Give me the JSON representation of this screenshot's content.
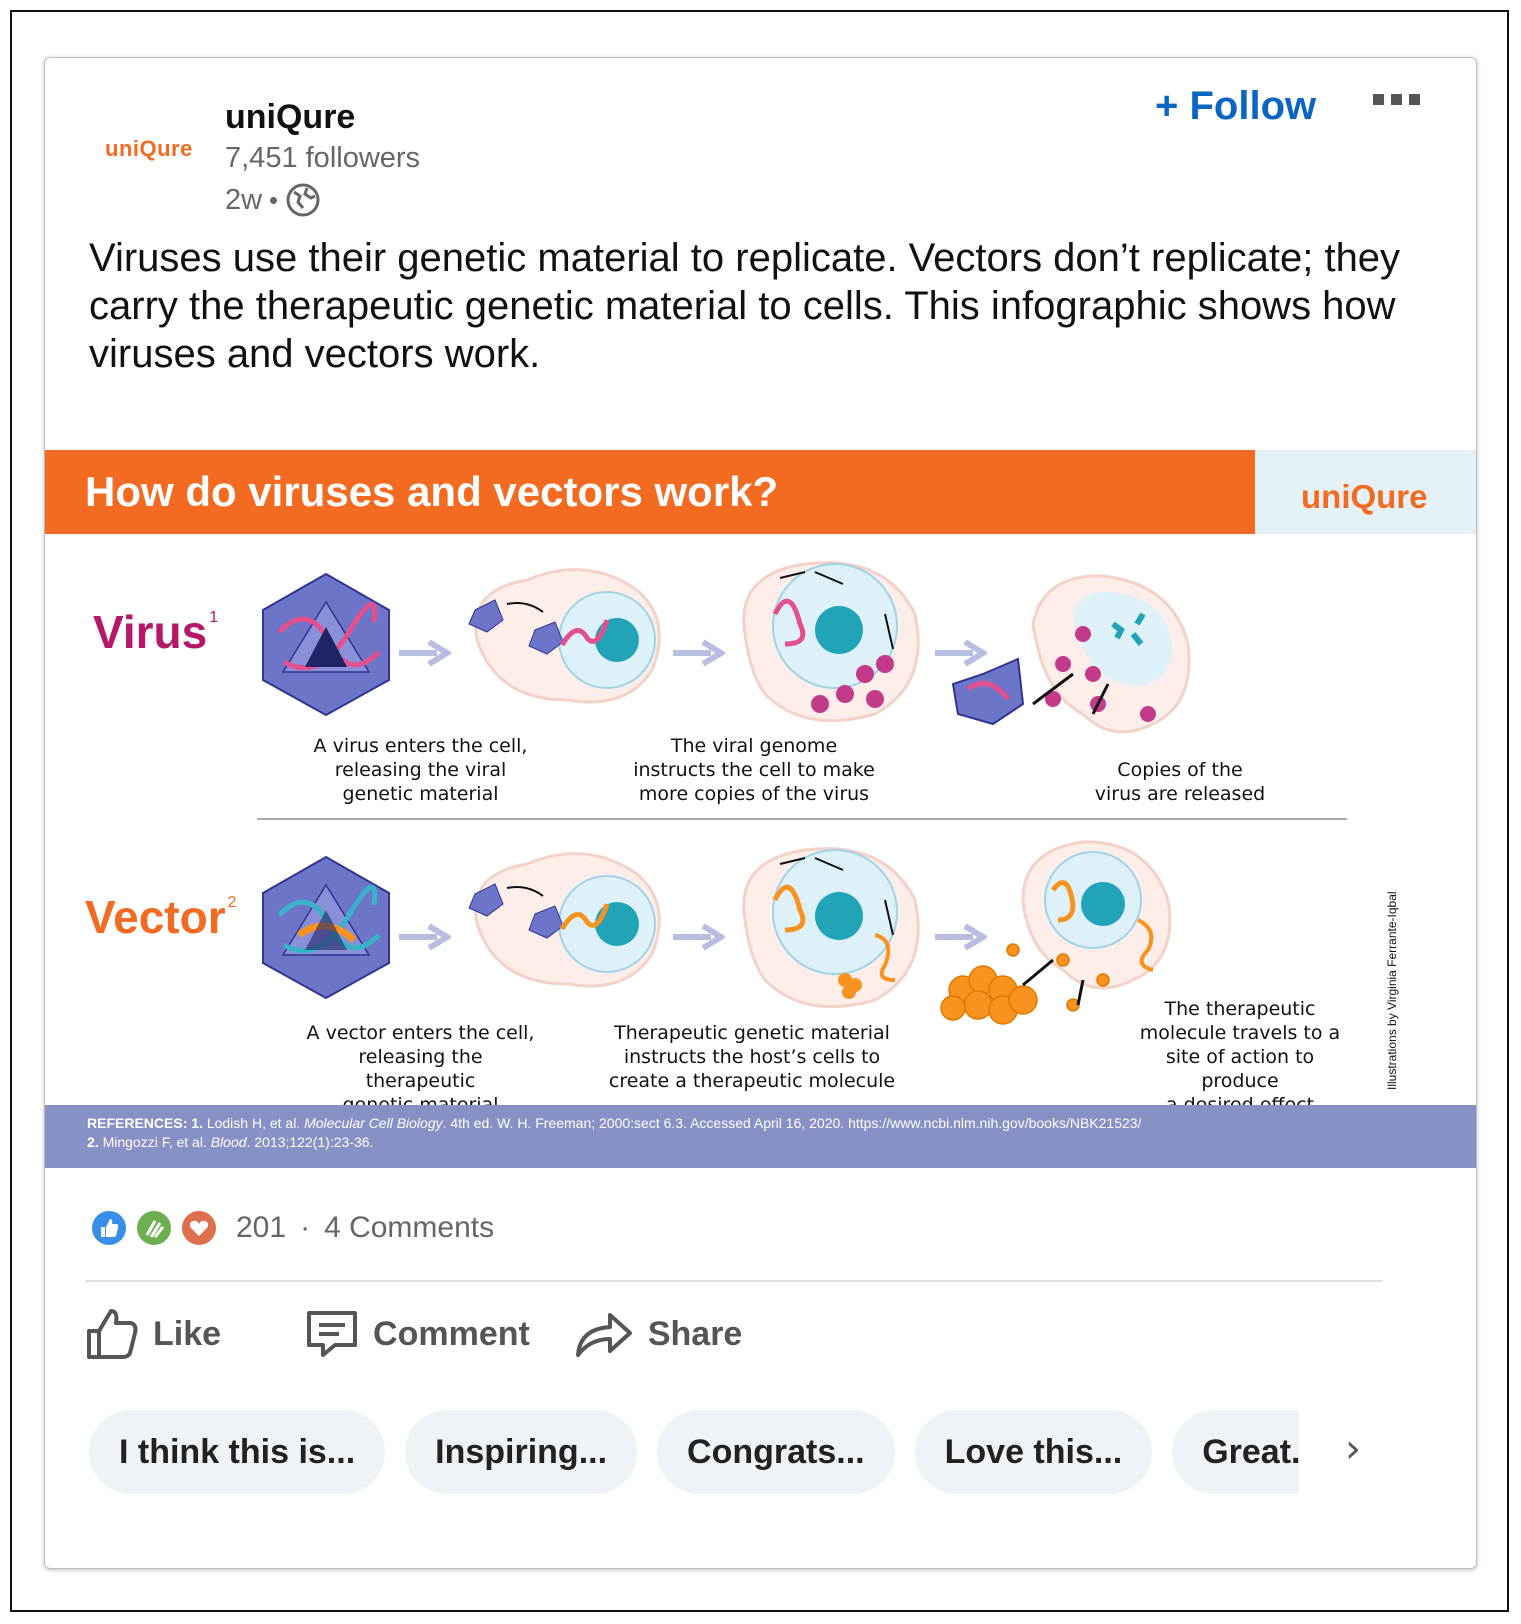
{
  "post": {
    "company": "uniQure",
    "logo_text": "uniQure",
    "followers": "7,451 followers",
    "age": "2w",
    "follow_label": "+ Follow",
    "text": "Viruses use their genetic material to replicate. Vectors don’t replicate; they carry the therapeutic genetic material to cells. This infographic shows how viruses and vectors work."
  },
  "infographic": {
    "title": "How do viruses and vectors work?",
    "brand": "uniQure",
    "virus_label": "Virus",
    "virus_sup": "1",
    "vector_label": "Vector",
    "vector_sup": "2",
    "virus_captions": [
      "A virus enters the cell,\nreleasing the viral\ngenetic material",
      "The viral genome\ninstructs the cell to make\nmore copies of the virus",
      "Copies of the\nvirus are released"
    ],
    "vector_captions": [
      "A vector enters the cell,\nreleasing the therapeutic\ngenetic material",
      "Therapeutic genetic material\ninstructs the host’s cells to\ncreate a therapeutic molecule",
      "The therapeutic\nmolecule travels to a\nsite of action to produce\na desired effect"
    ],
    "credit": "Illustrations by Virginia Ferrante-Iqbal",
    "refs": {
      "heading": "REFERENCES",
      "ref1_num": "1.",
      "ref1_authors": "Lodish H, et al.",
      "ref1_title": "Molecular Cell Biology",
      "ref1_rest": ". 4th ed. W. H. Freeman; 2000:sect 6.3. Accessed April 16, 2020. https://www.ncbi.nlm.nih.gov/books/NBK21523/",
      "ref2_num": "2.",
      "ref2_authors": "Mingozzi F, et al.",
      "ref2_title": "Blood",
      "ref2_rest": ". 2013;122(1):23-36."
    },
    "colors": {
      "orange": "#f26b21",
      "magenta": "#b5176b",
      "refs_bg": "#8791c5",
      "capsid": "#5a63b8"
    }
  },
  "social": {
    "reaction_count": "201",
    "separator": "·",
    "comments": "4 Comments",
    "reaction_icons": [
      "like-icon",
      "celebrate-icon",
      "love-icon"
    ]
  },
  "actions": {
    "like": "Like",
    "comment": "Comment",
    "share": "Share"
  },
  "chips": [
    "I think this is...",
    "Inspiring...",
    "Congrats...",
    "Love this...",
    "Great..."
  ],
  "chevron": "›"
}
